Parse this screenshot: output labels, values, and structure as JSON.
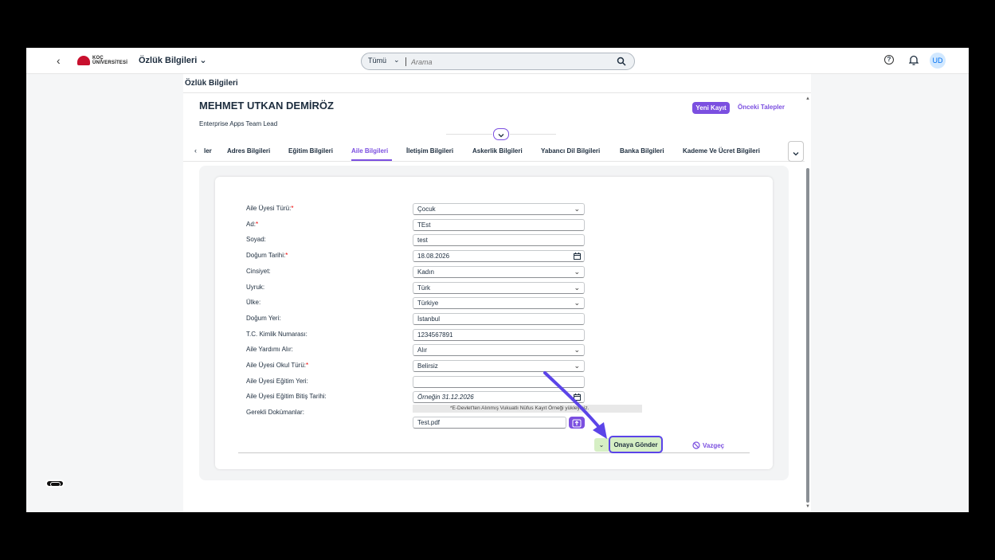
{
  "shell": {
    "logo_text_1": "KOÇ",
    "logo_text_2": "ÜNİVERSİTESİ",
    "app_title": "Özlük Bilgileri",
    "search_scope": "Tümü",
    "search_placeholder": "Arama",
    "avatar_initials": "UD"
  },
  "page": {
    "title": "Özlük Bilgileri",
    "employee_name": "MEHMET UTKAN DEMİRÖZ",
    "employee_role": "Enterprise Apps Team Lead",
    "new_record_label": "Yeni Kayıt",
    "previous_requests_label": "Önceki Talepler"
  },
  "tabs": [
    {
      "label": "ler"
    },
    {
      "label": "Adres Bilgileri"
    },
    {
      "label": "Eğitim Bilgileri"
    },
    {
      "label": "Aile Bilgileri"
    },
    {
      "label": "İletişim Bilgileri"
    },
    {
      "label": "Askerlik Bilgileri"
    },
    {
      "label": "Yabancı Dil Bilgileri"
    },
    {
      "label": "Banka Bilgileri"
    },
    {
      "label": "Kademe Ve Ücret Bilgileri"
    }
  ],
  "active_tab": "Aile Bilgileri",
  "form": {
    "fields": [
      {
        "label": "Aile Üyesi Türü:",
        "required": "*",
        "value": "Çocuk",
        "type": "select"
      },
      {
        "label": "Ad:",
        "required": "*",
        "value": "TEst",
        "type": "input"
      },
      {
        "label": "Soyad:",
        "required": "",
        "value": "test",
        "type": "input"
      },
      {
        "label": "Doğum Tarihi:",
        "required": "*",
        "value": "18.08.2026",
        "type": "date"
      },
      {
        "label": "Cinsiyet:",
        "required": "",
        "value": "Kadın",
        "type": "select"
      },
      {
        "label": "Uyruk:",
        "required": "",
        "value": "Türk",
        "type": "select"
      },
      {
        "label": "Ülke:",
        "required": "",
        "value": "Türkiye",
        "type": "select"
      },
      {
        "label": "Doğum Yeri:",
        "required": "",
        "value": "İstanbul",
        "type": "input"
      },
      {
        "label": "T.C. Kimlik Numarası:",
        "required": "",
        "value": "1234567891",
        "type": "input"
      },
      {
        "label": "Aile Yardımı Alır:",
        "required": "",
        "value": "Alır",
        "type": "select"
      },
      {
        "label": "Aile Üyesi Okul Türü:",
        "required": "*",
        "value": "Belirsiz",
        "type": "select"
      },
      {
        "label": "Aile Üyesi Eğitim Yeri:",
        "required": "",
        "value": "",
        "type": "input"
      },
      {
        "label": "Aile Üyesi Eğitim Bitiş Tarihi:",
        "required": "",
        "value": "Örneğin 31.12.2026",
        "type": "date"
      }
    ],
    "documents_label": "Gerekli Dokümanlar:",
    "documents_hint": "*E-Devlet'ten Alınmış Vukuatlı Nüfus Kayıt Örneği yükleyiniz.",
    "file_name": "Test.pdf",
    "submit_label": "Onaya Gönder",
    "cancel_label": "Vazgeç"
  },
  "colors": {
    "accent": "#7b4fe0",
    "submit_bg": "#d6efc4",
    "highlight_border": "#5b44e8",
    "required": "#e00000"
  }
}
